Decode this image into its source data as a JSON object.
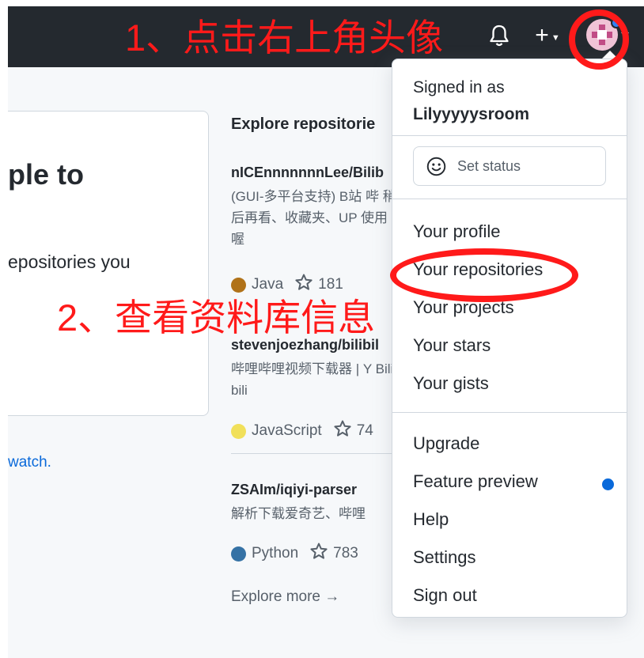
{
  "annotations": {
    "step1": "1、点击右上角头像",
    "step2": "2、查看资料库信息"
  },
  "header": {
    "icons": [
      "bell-icon",
      "plus-icon",
      "avatar"
    ],
    "plus_symbol": "+"
  },
  "left_card": {
    "title_fragment": "ple to",
    "text_fragment": "epositories you",
    "link_fragment": "watch."
  },
  "explore": {
    "title": "Explore repositorie",
    "repos": [
      {
        "name": "nICEnnnnnnnLee/Bilib",
        "description": "(GUI-多平台支持) B站 哔 稍后再看、收藏夹、UP 使用喔",
        "language": "Java",
        "language_color": "#b07219",
        "stars": "181"
      },
      {
        "name": "stevenjoezhang/bilibil",
        "description": "哔哩哔哩视频下载器 | Y Bilibili",
        "language": "JavaScript",
        "language_color": "#f1e05a",
        "stars": "74"
      },
      {
        "name": "ZSAIm/iqiyi-parser",
        "description": "解析下载爱奇艺、哔哩",
        "language": "Python",
        "language_color": "#3572a5",
        "stars": "783"
      }
    ],
    "more_link": "Explore more →"
  },
  "dropdown": {
    "signed_in_label": "Signed in as",
    "username": "Lilyyyyysroom",
    "set_status": "Set status",
    "items": [
      "Your profile",
      "Your repositories",
      "Your projects",
      "Your stars",
      "Your gists",
      "Upgrade",
      "Feature preview",
      "Help",
      "Settings",
      "Sign out"
    ]
  },
  "colors": {
    "header_bg": "#24292f",
    "annotation_red": "#ff1a1a",
    "link_blue": "#0969da",
    "notification_blue": "#2f81f7"
  }
}
